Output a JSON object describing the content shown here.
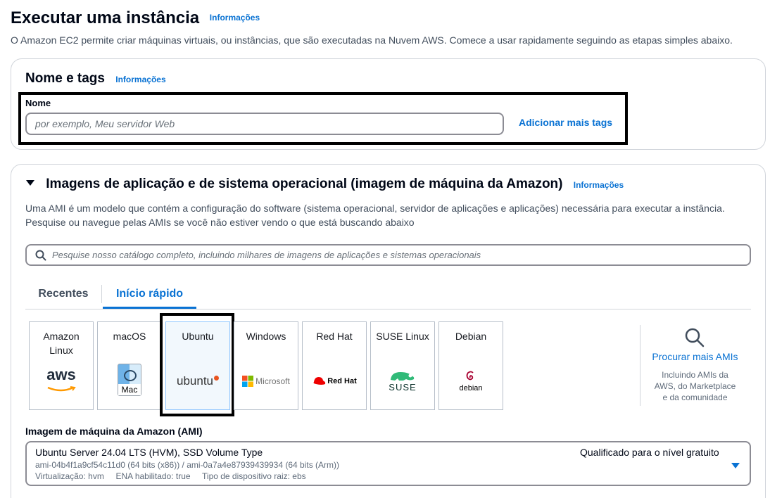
{
  "page": {
    "title": "Executar uma instância",
    "info": "Informações",
    "description": "O Amazon EC2 permite criar máquinas virtuais, ou instâncias, que são executadas na Nuvem AWS. Comece a usar rapidamente seguindo as etapas simples abaixo."
  },
  "name_tags": {
    "title": "Nome e tags",
    "info": "Informações",
    "field_label": "Nome",
    "placeholder": "por exemplo, Meu servidor Web",
    "add_tags": "Adicionar mais tags"
  },
  "ami_section": {
    "title": "Imagens de aplicação e de sistema operacional (imagem de máquina da Amazon)",
    "info": "Informações",
    "desc_line1": "Uma AMI é um modelo que contém a configuração do software (sistema operacional, servidor de aplicações e aplicações) necessária para executar a instância.",
    "desc_line2": "Pesquise ou navegue pelas AMIs se você não estiver vendo o que está buscando abaixo",
    "search_placeholder": "Pesquise nosso catálogo completo, incluindo milhares de imagens de aplicações e sistemas operacionais",
    "tabs": [
      "Recentes",
      "Início rápido"
    ],
    "active_tab": "Início rápido",
    "tiles": [
      {
        "name": "Amazon Linux",
        "logo": "aws"
      },
      {
        "name": "macOS",
        "logo": "Mac"
      },
      {
        "name": "Ubuntu",
        "logo": "ubuntu",
        "selected": true
      },
      {
        "name": "Windows",
        "logo": "Microsoft"
      },
      {
        "name": "Red Hat",
        "logo": "Red Hat"
      },
      {
        "name": "SUSE Linux",
        "logo": "SUSE"
      },
      {
        "name": "Debian",
        "logo": "debian"
      }
    ],
    "browse": {
      "label": "Procurar mais AMIs",
      "sub": "Incluindo AMIs da AWS, do Marketplace e da comunidade"
    },
    "ami_label": "Imagem de máquina da Amazon (AMI)",
    "selected_ami": {
      "name": "Ubuntu Server 24.04 LTS (HVM), SSD Volume Type",
      "ids": "ami-04b4f1a9cf54c11d0 (64 bits (x86)) / ami-0a7a4e87939439934 (64 bits (Arm))",
      "meta": "Virtualização: hvm     ENA habilitado: true     Tipo de dispositivo raiz: ebs",
      "badge": "Qualificado para o nível gratuito"
    }
  },
  "colors": {
    "link": "#0972d3",
    "selected_tile_bg": "#f2f8fd"
  }
}
